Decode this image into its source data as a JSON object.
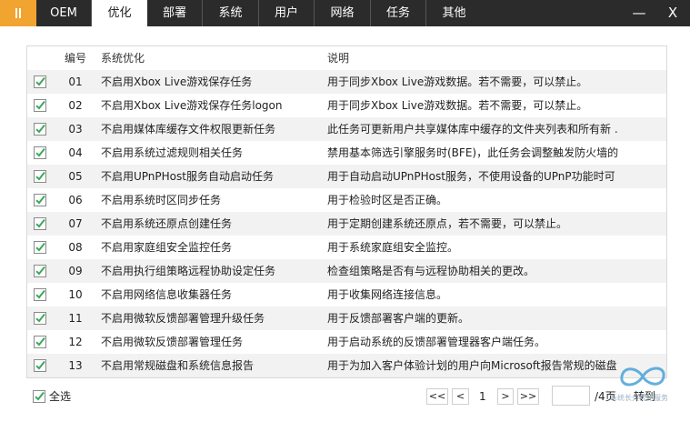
{
  "tabs": [
    {
      "label": "OEM",
      "active": false
    },
    {
      "label": "优化",
      "active": true
    },
    {
      "label": "部署",
      "active": false
    },
    {
      "label": "系统",
      "active": false
    },
    {
      "label": "用户",
      "active": false
    },
    {
      "label": "网络",
      "active": false
    },
    {
      "label": "任务",
      "active": false
    },
    {
      "label": "其他",
      "active": false
    }
  ],
  "window": {
    "minimize": "—",
    "close": "X",
    "accent": "#f2a431"
  },
  "table": {
    "headers": {
      "num": "编号",
      "name": "系统优化",
      "desc": "说明"
    },
    "rows": [
      {
        "num": "01",
        "name": "不启用Xbox Live游戏保存任务",
        "desc": "用于同步Xbox Live游戏数据。若不需要，可以禁止。",
        "checked": true
      },
      {
        "num": "02",
        "name": "不启用Xbox Live游戏保存任务logon",
        "desc": "用于同步Xbox Live游戏数据。若不需要，可以禁止。",
        "checked": true
      },
      {
        "num": "03",
        "name": "不启用媒体库缓存文件权限更新任务",
        "desc": "此任务可更新用户共享媒体库中缓存的文件夹列表和所有新 ..",
        "checked": true
      },
      {
        "num": "04",
        "name": "不启用系统过滤规则相关任务",
        "desc": "禁用基本筛选引擎服务时(BFE)，此任务会调整触发防火墙的 ..",
        "checked": true
      },
      {
        "num": "05",
        "name": "不启用UPnPHost服务自动启动任务",
        "desc": "用于自动启动UPnPHost服务，不使用设备的UPnP功能时可 ..",
        "checked": true
      },
      {
        "num": "06",
        "name": "不启用系统时区同步任务",
        "desc": "用于检验时区是否正确。",
        "checked": true
      },
      {
        "num": "07",
        "name": "不启用系统还原点创建任务",
        "desc": "用于定期创建系统还原点，若不需要，可以禁止。",
        "checked": true
      },
      {
        "num": "08",
        "name": "不启用家庭组安全监控任务",
        "desc": "用于系统家庭组安全监控。",
        "checked": true
      },
      {
        "num": "09",
        "name": "不启用执行组策略远程协助设定任务",
        "desc": "检查组策略是否有与远程协助相关的更改。",
        "checked": true
      },
      {
        "num": "10",
        "name": "不启用网络信息收集器任务",
        "desc": "用于收集网络连接信息。",
        "checked": true
      },
      {
        "num": "11",
        "name": "不启用微软反馈部署管理升级任务",
        "desc": "用于反馈部署客户端的更新。",
        "checked": true
      },
      {
        "num": "12",
        "name": "不启用微软反馈部署管理任务",
        "desc": "用于启动系统的反馈部署管理器客户端任务。",
        "checked": true
      },
      {
        "num": "13",
        "name": "不启用常规磁盘和系统信息报告",
        "desc": "用于为加入客户体验计划的用户向Microsoft报告常规的磁盘 ..",
        "checked": true
      }
    ]
  },
  "footer": {
    "select_all": "全选",
    "select_all_checked": true,
    "first": "<<",
    "prev": "<",
    "current_page": "1",
    "next": ">",
    "last": ">>",
    "page_input": "",
    "total_pages": "/4页",
    "jump": "转到"
  },
  "watermark": {
    "text": "系统长久优化服务"
  },
  "colors": {
    "check": "#3aa85a",
    "tab_bar": "#2b2b2b",
    "row_alt": "#f2f2f2"
  }
}
